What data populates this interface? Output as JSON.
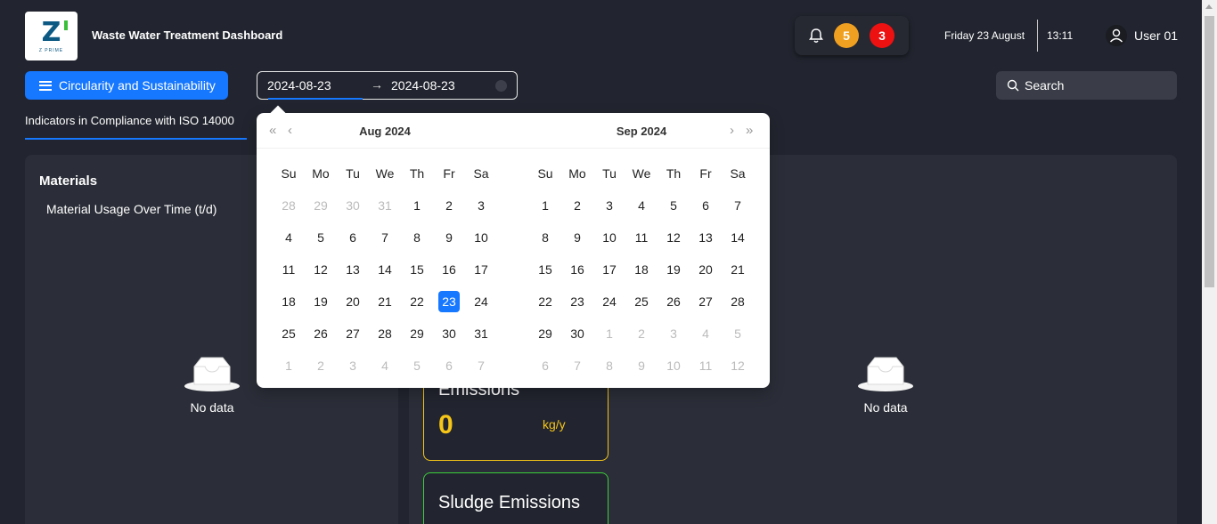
{
  "header": {
    "logo_text": "Z",
    "logo_subtext": "Z PRIME",
    "app_title": "Waste Water Treatment Dashboard",
    "notification_count_warning": "5",
    "notification_count_alert": "3",
    "date": "Friday 23 August",
    "time": "13:11",
    "user_name": "User 01"
  },
  "toolbar": {
    "menu_label": "Circularity and Sustainability",
    "range_start": "2024-08-23",
    "range_arrow": "→",
    "range_end": "2024-08-23",
    "search_placeholder": "Search"
  },
  "tabs": {
    "active": "Indicators in Compliance with ISO 14000"
  },
  "materials": {
    "title": "Materials",
    "subtitle": "Material Usage Over Time (t/d)",
    "empty_label": "No data"
  },
  "right_panel": {
    "empty_label": "No data"
  },
  "cards": {
    "emissions_title": "Emissions",
    "emissions_value": "0",
    "emissions_unit": "kg/y",
    "sludge_title": "Sludge Emissions"
  },
  "calendar": {
    "left_title": "Aug  2024",
    "right_title": "Sep  2024",
    "weekdays": [
      "Su",
      "Mo",
      "Tu",
      "We",
      "Th",
      "Fr",
      "Sa"
    ],
    "selected_day": "23",
    "left_weeks": [
      [
        [
          "28",
          1
        ],
        [
          "29",
          1
        ],
        [
          "30",
          1
        ],
        [
          "31",
          1
        ],
        [
          "1",
          0
        ],
        [
          "2",
          0
        ],
        [
          "3",
          0
        ]
      ],
      [
        [
          "4",
          0
        ],
        [
          "5",
          0
        ],
        [
          "6",
          0
        ],
        [
          "7",
          0
        ],
        [
          "8",
          0
        ],
        [
          "9",
          0
        ],
        [
          "10",
          0
        ]
      ],
      [
        [
          "11",
          0
        ],
        [
          "12",
          0
        ],
        [
          "13",
          0
        ],
        [
          "14",
          0
        ],
        [
          "15",
          0
        ],
        [
          "16",
          0
        ],
        [
          "17",
          0
        ]
      ],
      [
        [
          "18",
          0
        ],
        [
          "19",
          0
        ],
        [
          "20",
          0
        ],
        [
          "21",
          0
        ],
        [
          "22",
          0
        ],
        [
          "23",
          2
        ],
        [
          "24",
          0
        ]
      ],
      [
        [
          "25",
          0
        ],
        [
          "26",
          0
        ],
        [
          "27",
          0
        ],
        [
          "28",
          0
        ],
        [
          "29",
          0
        ],
        [
          "30",
          0
        ],
        [
          "31",
          0
        ]
      ],
      [
        [
          "1",
          1
        ],
        [
          "2",
          1
        ],
        [
          "3",
          1
        ],
        [
          "4",
          1
        ],
        [
          "5",
          1
        ],
        [
          "6",
          1
        ],
        [
          "7",
          1
        ]
      ]
    ],
    "right_weeks": [
      [
        [
          "1",
          0
        ],
        [
          "2",
          0
        ],
        [
          "3",
          0
        ],
        [
          "4",
          0
        ],
        [
          "5",
          0
        ],
        [
          "6",
          0
        ],
        [
          "7",
          0
        ]
      ],
      [
        [
          "8",
          0
        ],
        [
          "9",
          0
        ],
        [
          "10",
          0
        ],
        [
          "11",
          0
        ],
        [
          "12",
          0
        ],
        [
          "13",
          0
        ],
        [
          "14",
          0
        ]
      ],
      [
        [
          "15",
          0
        ],
        [
          "16",
          0
        ],
        [
          "17",
          0
        ],
        [
          "18",
          0
        ],
        [
          "19",
          0
        ],
        [
          "20",
          0
        ],
        [
          "21",
          0
        ]
      ],
      [
        [
          "22",
          0
        ],
        [
          "23",
          0
        ],
        [
          "24",
          0
        ],
        [
          "25",
          0
        ],
        [
          "26",
          0
        ],
        [
          "27",
          0
        ],
        [
          "28",
          0
        ]
      ],
      [
        [
          "29",
          0
        ],
        [
          "30",
          0
        ],
        [
          "1",
          1
        ],
        [
          "2",
          1
        ],
        [
          "3",
          1
        ],
        [
          "4",
          1
        ],
        [
          "5",
          1
        ]
      ],
      [
        [
          "6",
          1
        ],
        [
          "7",
          1
        ],
        [
          "8",
          1
        ],
        [
          "9",
          1
        ],
        [
          "10",
          1
        ],
        [
          "11",
          1
        ],
        [
          "12",
          1
        ]
      ]
    ]
  },
  "colors": {
    "accent": "#1677ff",
    "warning": "#f0a020",
    "alert": "#ee1111",
    "emissions_border": "#f5c518",
    "sludge_border": "#3ccf3c"
  }
}
